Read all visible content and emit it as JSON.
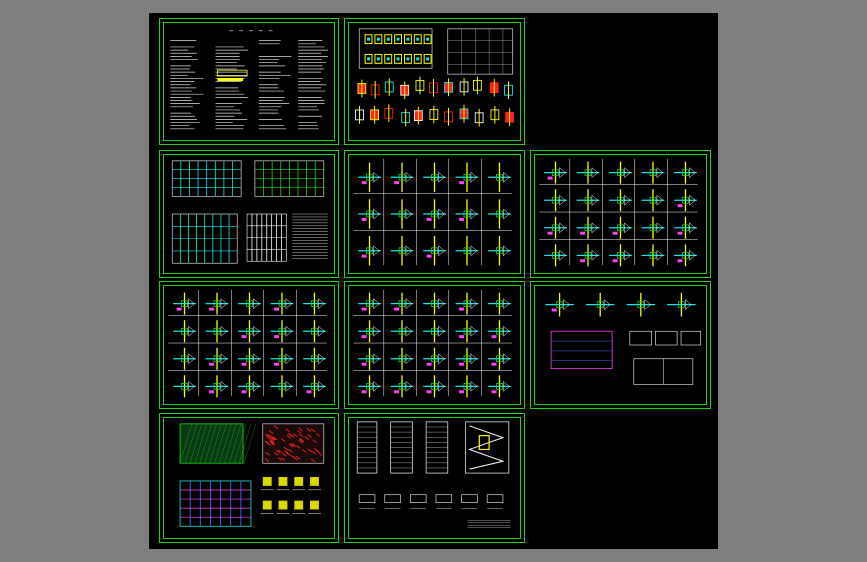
{
  "app": {
    "background": "#000000",
    "frame_color": "#1fd31f",
    "chrome_color": "#7f7f7f"
  },
  "colors": {
    "frame": "#1fd31f",
    "cyan": "#19e6e6",
    "yellow": "#ffff00",
    "red": "#ff2020",
    "magenta": "#ff40ff",
    "white": "#ffffff",
    "blue": "#3b6bff",
    "green": "#19d919"
  },
  "sheets": [
    {
      "id": "general-notes",
      "kind": "notes"
    },
    {
      "id": "foundation-plan",
      "kind": "foundation"
    },
    {
      "id": "column-layout",
      "kind": "plans"
    },
    {
      "id": "frame-details-a",
      "kind": "details"
    },
    {
      "id": "joint-details-a",
      "kind": "details"
    },
    {
      "id": "joint-details-b",
      "kind": "details"
    },
    {
      "id": "joint-details-c",
      "kind": "details"
    },
    {
      "id": "roof-plan",
      "kind": "plan-detail"
    },
    {
      "id": "roof-framing",
      "kind": "roof"
    },
    {
      "id": "elevations",
      "kind": "elevations"
    }
  ]
}
